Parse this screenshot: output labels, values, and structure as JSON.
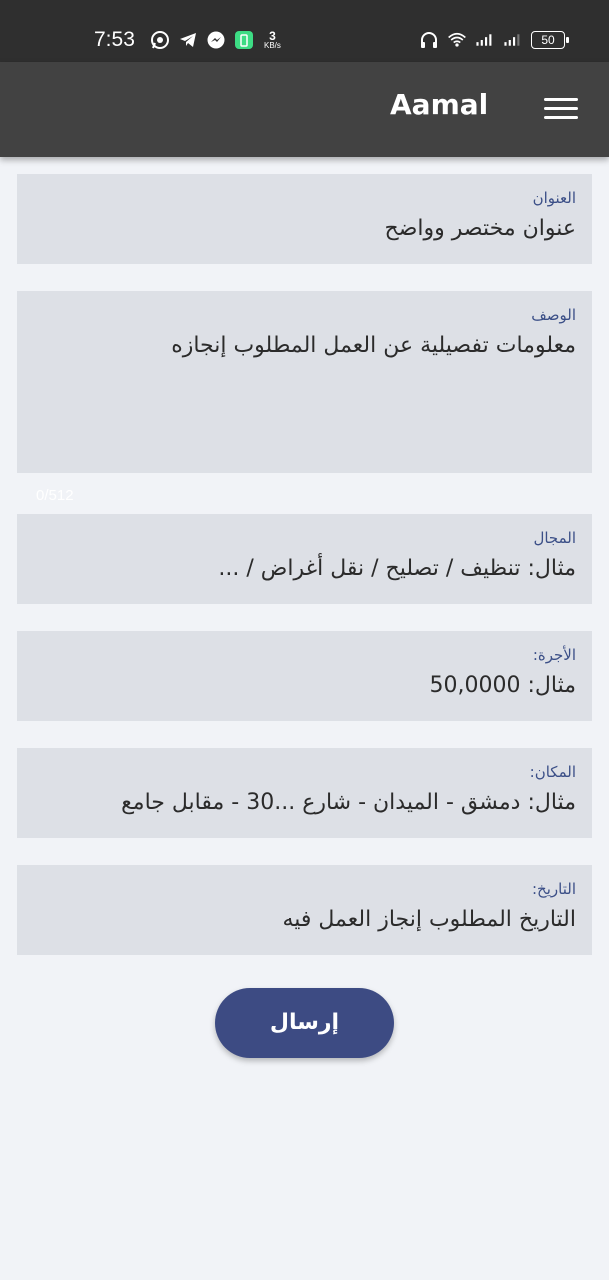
{
  "status_bar": {
    "time": "7:53",
    "net_speed_value": "3",
    "net_speed_unit": "KB/s",
    "battery_level": "50"
  },
  "app_bar": {
    "title": "Aamal"
  },
  "form": {
    "title_field": {
      "label": "العنوان",
      "placeholder": "عنوان مختصر وواضح"
    },
    "description_field": {
      "label": "الوصف",
      "placeholder": "معلومات تفصيلية عن العمل المطلوب إنجازه",
      "counter": "0/512"
    },
    "category_field": {
      "label": "المجال",
      "placeholder": "مثال: تنظيف / تصليح / نقل أغراض / ..."
    },
    "wage_field": {
      "label": "الأجرة:",
      "placeholder": "مثال: 50,0000"
    },
    "location_field": {
      "label": "المكان:",
      "placeholder": "مثال: دمشق - الميدان - شارع ...30 - مقابل جامع"
    },
    "date_field": {
      "label": "التاريخ:",
      "placeholder": "التاريخ المطلوب إنجاز العمل فيه"
    },
    "submit_label": "إرسال"
  },
  "colors": {
    "status_bar": "#2f2f2f",
    "app_bar": "#424242",
    "field_bg": "#dde0e6",
    "label": "#3b4f87",
    "button": "#3d4b83",
    "page_bg": "#f1f3f7"
  }
}
